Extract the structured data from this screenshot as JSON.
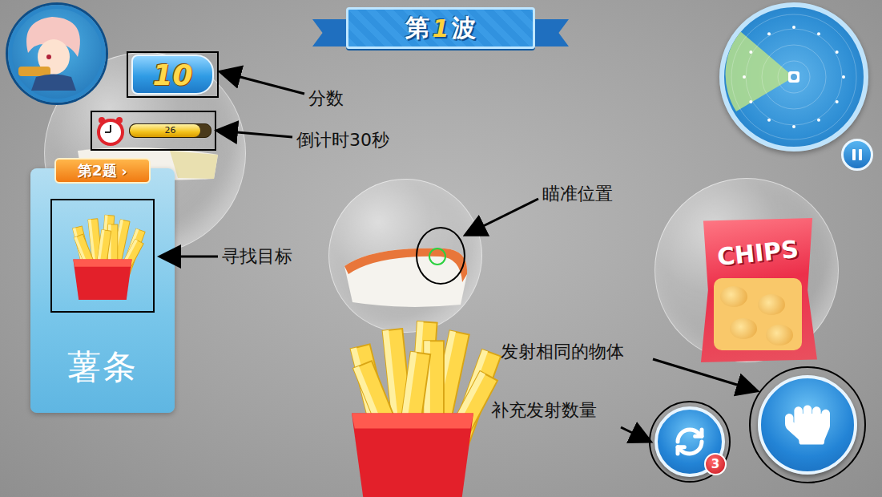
{
  "wave_banner": {
    "prefix": "第",
    "number": "1",
    "suffix": "波"
  },
  "score": "10",
  "timer": {
    "reading": "26",
    "level": 0.87
  },
  "question": {
    "badge": "第2题",
    "chevron": "›",
    "target_name": "薯条"
  },
  "chips_label": "CHIPS",
  "reload": {
    "count": "3"
  },
  "annotations": [
    {
      "label": "分数"
    },
    {
      "label": "倒计时30秒"
    },
    {
      "label": "瞄准位置"
    },
    {
      "label": "寻找目标"
    },
    {
      "label": "发射相同的物体"
    },
    {
      "label": "补充发射数量"
    }
  ]
}
